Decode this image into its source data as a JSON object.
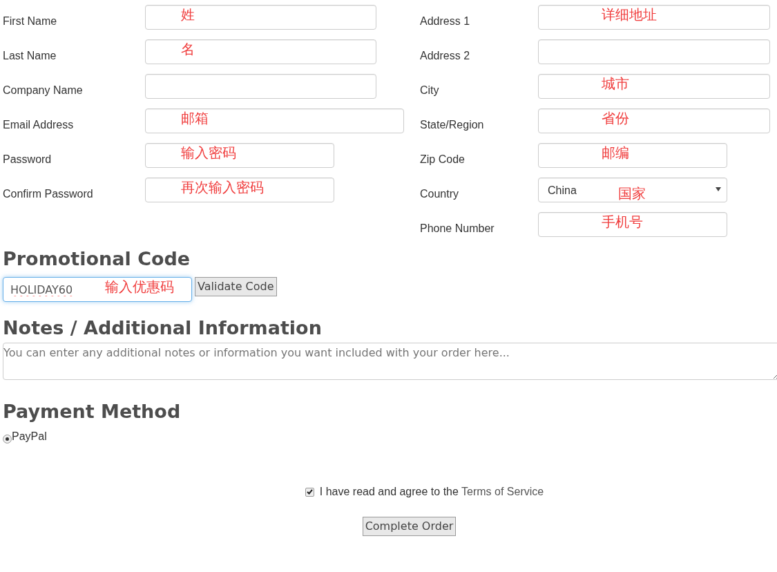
{
  "account": {
    "fields": [
      {
        "label": "First Name",
        "annotation": "姓"
      },
      {
        "label": "Last Name",
        "annotation": "名"
      },
      {
        "label": "Company Name"
      },
      {
        "label": "Email Address",
        "annotation": "邮箱"
      },
      {
        "label": "Password",
        "annotation": "输入密码"
      },
      {
        "label": "Confirm Password",
        "annotation": "再次输入密码"
      }
    ]
  },
  "address": {
    "fields": [
      {
        "label": "Address 1",
        "kind": "text",
        "annotation": "详细地址"
      },
      {
        "label": "Address 2",
        "kind": "text"
      },
      {
        "label": "City",
        "kind": "text",
        "annotation": "城市"
      },
      {
        "label": "State/Region",
        "kind": "text",
        "annotation": "省份"
      },
      {
        "label": "Zip Code",
        "kind": "text",
        "annotation": "邮编"
      },
      {
        "label": "Country",
        "kind": "select",
        "value": "China",
        "annotation": "国家"
      },
      {
        "label": "Phone Number",
        "kind": "text",
        "annotation": "手机号"
      }
    ]
  },
  "promo": {
    "heading": "Promotional Code",
    "value": "HOLIDAY60",
    "annotation": "输入优惠码",
    "button": "Validate Code"
  },
  "notes": {
    "heading": "Notes / Additional Information",
    "placeholder": "You can enter any additional notes or information you want included with your order here..."
  },
  "payment": {
    "heading": "Payment Method",
    "options": [
      {
        "label": "PayPal",
        "selected": true
      }
    ]
  },
  "terms": {
    "text": "I have read and agree to the",
    "link": "Terms of Service",
    "checked": true
  },
  "submit": "Complete Order"
}
